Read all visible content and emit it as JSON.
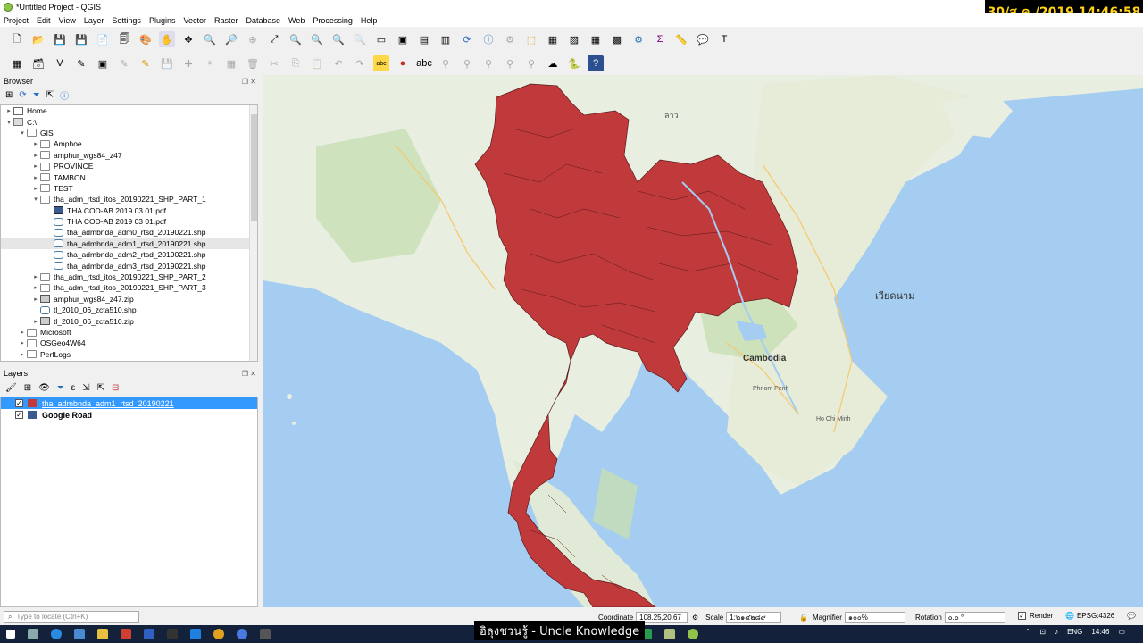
{
  "window": {
    "title": "*Untitled Project - QGIS"
  },
  "clock": "30/ส.ค./2019 14:46:58",
  "menu": [
    "Project",
    "Edit",
    "View",
    "Layer",
    "Settings",
    "Plugins",
    "Vector",
    "Raster",
    "Database",
    "Web",
    "Processing",
    "Help"
  ],
  "browser": {
    "title": "Browser",
    "items": [
      {
        "label": "Home",
        "indent": 0,
        "arrow": "▸",
        "icon": "home"
      },
      {
        "label": "C:\\",
        "indent": 0,
        "arrow": "▾",
        "icon": "drive"
      },
      {
        "label": "GIS",
        "indent": 1,
        "arrow": "▾",
        "icon": "folder"
      },
      {
        "label": "Amphoe",
        "indent": 2,
        "arrow": "▸",
        "icon": "folder"
      },
      {
        "label": "amphur_wgs84_z47",
        "indent": 2,
        "arrow": "▸",
        "icon": "folder"
      },
      {
        "label": "PROVINCE",
        "indent": 2,
        "arrow": "▸",
        "icon": "folder"
      },
      {
        "label": "TAMBON",
        "indent": 2,
        "arrow": "▸",
        "icon": "folder"
      },
      {
        "label": "TEST",
        "indent": 2,
        "arrow": "▸",
        "icon": "folder"
      },
      {
        "label": "tha_adm_rtsd_itos_20190221_SHP_PART_1",
        "indent": 2,
        "arrow": "▾",
        "icon": "folder"
      },
      {
        "label": "THA COD-AB 2019 03 01.pdf",
        "indent": 3,
        "arrow": "",
        "icon": "raster"
      },
      {
        "label": "THA COD-AB 2019 03 01.pdf",
        "indent": 3,
        "arrow": "",
        "icon": "vec"
      },
      {
        "label": "tha_admbnda_adm0_rtsd_20190221.shp",
        "indent": 3,
        "arrow": "",
        "icon": "vec"
      },
      {
        "label": "tha_admbnda_adm1_rtsd_20190221.shp",
        "indent": 3,
        "arrow": "",
        "icon": "vec",
        "selected": true
      },
      {
        "label": "tha_admbnda_adm2_rtsd_20190221.shp",
        "indent": 3,
        "arrow": "",
        "icon": "vec"
      },
      {
        "label": "tha_admbnda_adm3_rtsd_20190221.shp",
        "indent": 3,
        "arrow": "",
        "icon": "vec"
      },
      {
        "label": "tha_adm_rtsd_itos_20190221_SHP_PART_2",
        "indent": 2,
        "arrow": "▸",
        "icon": "folder"
      },
      {
        "label": "tha_adm_rtsd_itos_20190221_SHP_PART_3",
        "indent": 2,
        "arrow": "▸",
        "icon": "folder"
      },
      {
        "label": "amphur_wgs84_z47.zip",
        "indent": 2,
        "arrow": "▸",
        "icon": "zip"
      },
      {
        "label": "tl_2010_06_zcta510.shp",
        "indent": 2,
        "arrow": "",
        "icon": "vec"
      },
      {
        "label": "tl_2010_06_zcta510.zip",
        "indent": 2,
        "arrow": "▸",
        "icon": "zip"
      },
      {
        "label": "Microsoft",
        "indent": 1,
        "arrow": "▸",
        "icon": "folder"
      },
      {
        "label": "OSGeo4W64",
        "indent": 1,
        "arrow": "▸",
        "icon": "folder"
      },
      {
        "label": "PerfLogs",
        "indent": 1,
        "arrow": "▸",
        "icon": "folder"
      }
    ]
  },
  "layers": {
    "title": "Layers",
    "items": [
      {
        "label": "tha_admbnda_adm1_rtsd_20190221",
        "color": "#c0393b",
        "checked": true,
        "selected": true
      },
      {
        "label": "Google Road",
        "color": "#3a5a90",
        "checked": true,
        "selected": false
      }
    ]
  },
  "map": {
    "labels": {
      "laos": "ลาว",
      "vietnam": "เวียดนาม",
      "cambodia": "Cambodia",
      "phnom_penh": "Phnom Penh",
      "hcmc": "Ho Chi Minh"
    },
    "polygon_color": "#c0393b",
    "water_color": "#a4cdf1",
    "land_color": "#e8eee0"
  },
  "status": {
    "locate_placeholder": "Type to locate (Ctrl+K)",
    "coordinate_label": "Coordinate",
    "coordinate": "108.25,20.67",
    "scale_label": "Scale",
    "scale": "1:๒๑๔๒๘๙",
    "magnifier_label": "Magnifier",
    "magnifier": "๑๐๐%",
    "rotation_label": "Rotation",
    "rotation": "๐.๐ °",
    "render_label": "Render",
    "crs": "EPSG:4326"
  },
  "caption": "อิลุงชวนรู้ - Uncle Knowledge",
  "tray": {
    "lang": "ENG",
    "time": "14:46"
  }
}
